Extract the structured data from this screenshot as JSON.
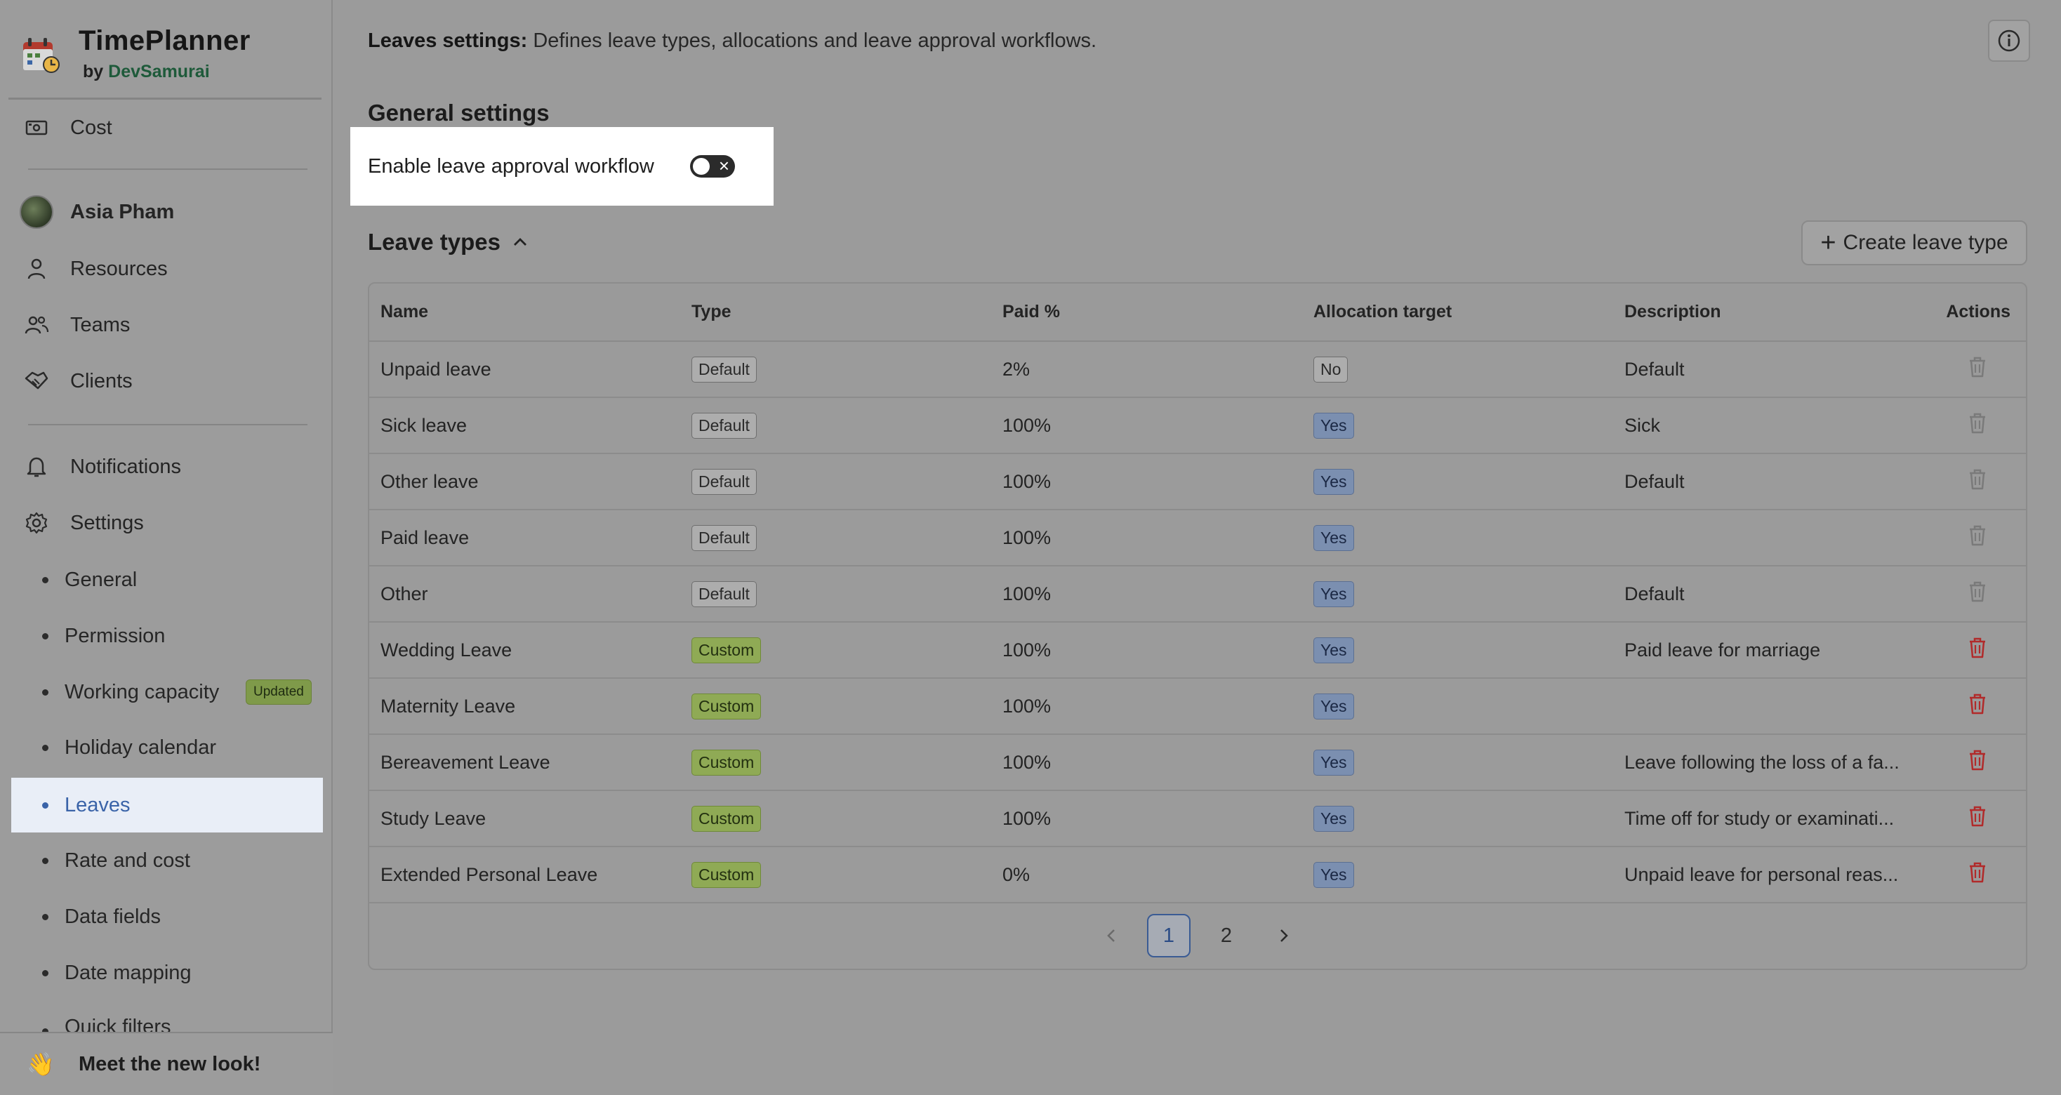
{
  "brand": {
    "name": "TimePlanner",
    "by": "by",
    "company": "DevSamurai"
  },
  "sidebar": {
    "top_items": [
      {
        "label": "Cost",
        "icon": "money-icon"
      }
    ],
    "user": {
      "name": "Asia Pham"
    },
    "main_items": [
      {
        "label": "Resources",
        "icon": "person-icon"
      },
      {
        "label": "Teams",
        "icon": "team-icon"
      },
      {
        "label": "Clients",
        "icon": "handshake-icon"
      }
    ],
    "notifications": "Notifications",
    "settings": "Settings",
    "settings_items": [
      {
        "label": "General"
      },
      {
        "label": "Permission"
      },
      {
        "label": "Working capacity",
        "badge": "Updated"
      },
      {
        "label": "Holiday calendar"
      },
      {
        "label": "Leaves",
        "active": true
      },
      {
        "label": "Rate and cost"
      },
      {
        "label": "Data fields"
      },
      {
        "label": "Date mapping"
      },
      {
        "label": "Quick filters"
      }
    ],
    "footer": {
      "label": "Meet the new look!",
      "emoji": "👋"
    }
  },
  "header": {
    "title_bold": "Leaves settings:",
    "description": "Defines leave types, allocations and leave approval workflows."
  },
  "general": {
    "title": "General settings",
    "toggle_label": "Enable leave approval workflow",
    "toggle_on": false
  },
  "leave_types": {
    "title": "Leave types",
    "create_label": "Create leave type",
    "columns": [
      "Name",
      "Type",
      "Paid %",
      "Allocation target",
      "Description",
      "Actions"
    ],
    "rows": [
      {
        "name": "Unpaid leave",
        "type": "Default",
        "paid": "2%",
        "alloc": "No",
        "desc": "Default",
        "deletable": false
      },
      {
        "name": "Sick leave",
        "type": "Default",
        "paid": "100%",
        "alloc": "Yes",
        "desc": "Sick",
        "deletable": false
      },
      {
        "name": "Other leave",
        "type": "Default",
        "paid": "100%",
        "alloc": "Yes",
        "desc": "Default",
        "deletable": false
      },
      {
        "name": "Paid leave",
        "type": "Default",
        "paid": "100%",
        "alloc": "Yes",
        "desc": "",
        "deletable": false
      },
      {
        "name": "Other",
        "type": "Default",
        "paid": "100%",
        "alloc": "Yes",
        "desc": "Default",
        "deletable": false
      },
      {
        "name": "Wedding Leave",
        "type": "Custom",
        "paid": "100%",
        "alloc": "Yes",
        "desc": "Paid leave for marriage",
        "deletable": true
      },
      {
        "name": "Maternity Leave",
        "type": "Custom",
        "paid": "100%",
        "alloc": "Yes",
        "desc": "",
        "deletable": true
      },
      {
        "name": "Bereavement Leave",
        "type": "Custom",
        "paid": "100%",
        "alloc": "Yes",
        "desc": "Leave following the loss of a fa...",
        "deletable": true
      },
      {
        "name": "Study Leave",
        "type": "Custom",
        "paid": "100%",
        "alloc": "Yes",
        "desc": "Time off for study or examinati...",
        "deletable": true
      },
      {
        "name": "Extended Personal Leave",
        "type": "Custom",
        "paid": "0%",
        "alloc": "Yes",
        "desc": "Unpaid leave for personal reas...",
        "deletable": true
      }
    ],
    "pagination": {
      "pages": [
        "1",
        "2"
      ],
      "current": "1"
    }
  },
  "colors": {
    "active_blue": "#3a63a8",
    "danger": "#b12a2a",
    "disabled_icon": "#7a7a7a"
  }
}
